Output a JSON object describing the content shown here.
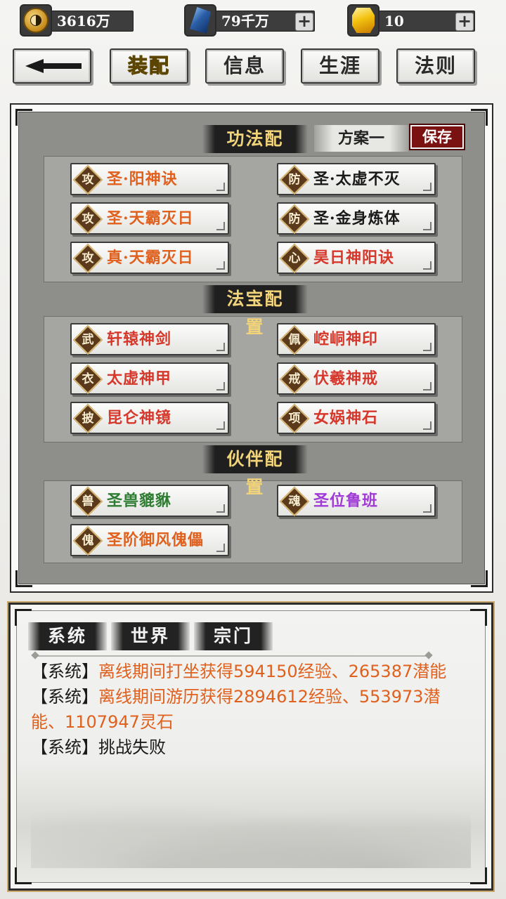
{
  "resources": {
    "coins": "3616万",
    "crystals": "79千万",
    "gems": "10",
    "coin_icon": "taiji-coin-icon",
    "crystal_icon": "blue-crystal-icon",
    "gem_icon": "gold-gem-icon"
  },
  "nav": {
    "back_icon": "back-arrow-icon",
    "tabs": [
      "装配",
      "信息",
      "生涯",
      "法则"
    ],
    "active_tab": "装配"
  },
  "config": {
    "skills_title": "功法配置",
    "scheme_label": "方案一",
    "save_label": "保存",
    "skills": [
      {
        "tag": "攻",
        "name": "圣·阳神诀",
        "color": "#e0601e"
      },
      {
        "tag": "防",
        "name": "圣·太虚不灭",
        "color": "#1a1a1a"
      },
      {
        "tag": "攻",
        "name": "圣·天霸灭日",
        "color": "#e0601e"
      },
      {
        "tag": "防",
        "name": "圣·金身炼体",
        "color": "#1a1a1a"
      },
      {
        "tag": "攻",
        "name": "真·天霸灭日",
        "color": "#e0601e"
      },
      {
        "tag": "心",
        "name": "昊日神阳诀",
        "color": "#d6382c"
      }
    ],
    "treasure_title": "法宝配置",
    "treasures": [
      {
        "tag": "武",
        "name": "轩辕神剑",
        "color": "#d6382c"
      },
      {
        "tag": "佩",
        "name": "崆峒神印",
        "color": "#d6382c"
      },
      {
        "tag": "衣",
        "name": "太虚神甲",
        "color": "#d6382c"
      },
      {
        "tag": "戒",
        "name": "伏羲神戒",
        "color": "#d6382c"
      },
      {
        "tag": "披",
        "name": "昆仑神镜",
        "color": "#d6382c"
      },
      {
        "tag": "项",
        "name": "女娲神石",
        "color": "#d6382c"
      }
    ],
    "partner_title": "伙伴配置",
    "partners": [
      {
        "tag": "兽",
        "name": "圣兽貔貅",
        "color": "#2e7d32"
      },
      {
        "tag": "魂",
        "name": "圣位鲁班",
        "color": "#a13bd6"
      },
      {
        "tag": "傀",
        "name": "圣阶御风傀儡",
        "color": "#e0601e"
      }
    ]
  },
  "chat": {
    "tabs": [
      "系统",
      "世界",
      "宗门"
    ],
    "messages": [
      {
        "who": "【系统】",
        "text": "离线期间打坐获得594150经验、265387潜能",
        "highlight": true
      },
      {
        "who": "【系统】",
        "text": "离线期间游历获得2894612经验、553973潜能、1107947灵石",
        "highlight": true
      },
      {
        "who": "【系统】",
        "text": "挑战失败",
        "highlight": false
      }
    ]
  }
}
